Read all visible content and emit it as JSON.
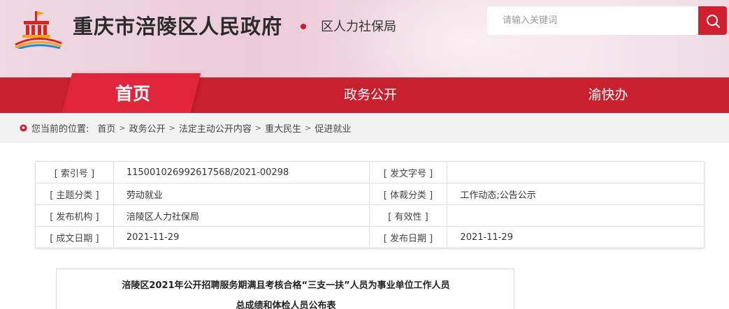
{
  "header": {
    "site_title": "重庆市涪陵区人民政府",
    "dept_name": "区人力社保局",
    "logo_icon": "government-building-logo-icon"
  },
  "search": {
    "placeholder": "请输入关键词",
    "button_icon": "search-icon"
  },
  "nav": {
    "items": [
      {
        "label": "首页",
        "active": true
      },
      {
        "label": "政务公开",
        "active": false
      },
      {
        "label": "渝快办",
        "active": false
      }
    ]
  },
  "breadcrumb": {
    "lead": "您当前的位置:",
    "items": [
      "首页",
      "政务公开",
      "法定主动公开内容",
      "重大民生",
      "促进就业"
    ],
    "separator": ">"
  },
  "meta": {
    "rows": [
      [
        {
          "k": "[ 索引号 ]",
          "v": "11500102699261756​8/2021-00298"
        },
        {
          "k": "[ 发文字号 ]",
          "v": ""
        }
      ],
      [
        {
          "k": "[ 主题分类 ]",
          "v": "劳动就业"
        },
        {
          "k": "[ 体裁分类 ]",
          "v": "工作动态;公告公示"
        }
      ],
      [
        {
          "k": "[ 发布机构 ]",
          "v": "涪陵区人力社保局"
        },
        {
          "k": "[ 有效性 ]",
          "v": ""
        }
      ],
      [
        {
          "k": "[ 成文日期 ]",
          "v": "2021-11-29"
        },
        {
          "k": "[ 发布日期 ]",
          "v": "2021-11-29"
        }
      ]
    ]
  },
  "document": {
    "title_line1": "涪陵区2021年公开招聘服务期满且考核合格“三支一扶”人员为事业单位工作人员",
    "title_line2": "总成绩和体检人员公布表"
  },
  "colors": {
    "brand_red": "#c8202f",
    "active_red": "#e0243a",
    "header_pink": "#eccbd8"
  }
}
